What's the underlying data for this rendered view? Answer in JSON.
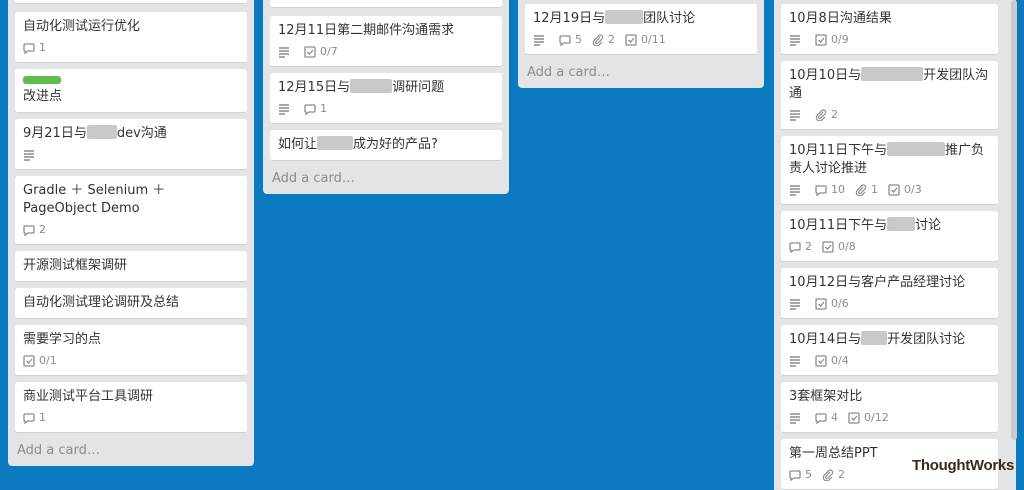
{
  "lists": [
    {
      "cards": [
        {
          "title": "自动化测试运行优化",
          "comments": "1"
        },
        {
          "label": "green",
          "title": "改进点"
        },
        {
          "title_pre": "9月21日与",
          "title_post": "dev沟通",
          "desc": true
        },
        {
          "title": "Gradle ＋ Selenium ＋ PageObject Demo",
          "comments": "2"
        },
        {
          "title": "开源测试框架调研"
        },
        {
          "title": "自动化测试理论调研及总结"
        },
        {
          "title": "需要学习的点",
          "checklist": "0/1"
        },
        {
          "title": "商业测试平台工具调研",
          "comments": "1"
        }
      ],
      "add_card": "Add a card…"
    },
    {
      "cards": [
        {
          "title": "12月11日第二期邮件沟通需求",
          "desc": true,
          "checklist": "0/7"
        },
        {
          "title_pre": "12月15日与",
          "title_post": "调研问题",
          "desc": true,
          "comments": "1"
        },
        {
          "title_pre": "如何让",
          "title_post": "成为好的产品?"
        }
      ],
      "add_card": "Add a card…"
    },
    {
      "cards": [
        {
          "title_pre": "12月19日与",
          "title_post": "团队讨论",
          "desc": true,
          "comments": "5",
          "attachments": "2",
          "checklist": "0/11"
        }
      ],
      "add_card": "Add a card…"
    },
    {
      "cards": [
        {
          "title": "10月8日沟通结果",
          "desc": true,
          "checklist": "0/9"
        },
        {
          "title_pre": "10月10日与",
          "title_post": "开发团队沟通",
          "desc": true,
          "attachments": "2"
        },
        {
          "title_pre": "10月11日下午与",
          "title_post": "推广负责人讨论推进",
          "desc": true,
          "comments": "10",
          "attachments": "1",
          "checklist": "0/3"
        },
        {
          "title_pre": "10月11日下午与",
          "title_post": "讨论",
          "comments": "2",
          "checklist": "0/8"
        },
        {
          "title": "10月12日与客户产品经理讨论",
          "desc": true,
          "checklist": "0/6"
        },
        {
          "title_pre": "10月14日与",
          "title_post": "开发团队讨论",
          "desc": true,
          "checklist": "0/4"
        },
        {
          "title": "3套框架对比",
          "desc": true,
          "comments": "4",
          "checklist": "0/12"
        },
        {
          "title": "第一周总结PPT",
          "comments": "5",
          "attachments": "2"
        }
      ]
    }
  ],
  "watermark": "ThoughtWorks",
  "colors": {
    "board_bg": "#0b79bf",
    "list_bg": "#e2e4e6",
    "label_green": "#61bd4f"
  }
}
